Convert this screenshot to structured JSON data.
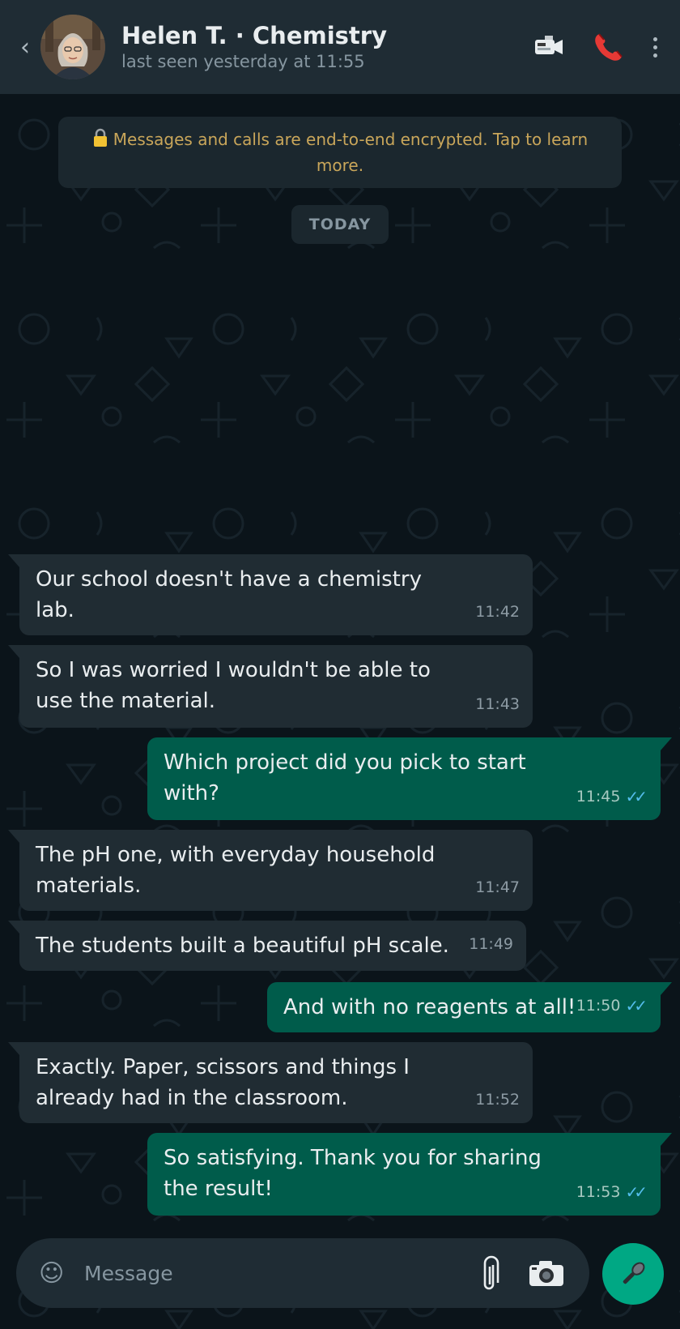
{
  "header": {
    "back_icon": "chevron-left-icon",
    "name": "Helen T. · Chemistry",
    "status": "last seen yesterday at 11:55",
    "icons": [
      "video-call-icon",
      "phone-call-icon",
      "more-vert-icon"
    ]
  },
  "encryption_notice": "Messages and calls are end-to-end encrypted. Tap to learn more.",
  "date_chip": "TODAY",
  "messages": [
    {
      "dir": "in",
      "text": "Our school doesn't have a chemistry lab.",
      "time": "11:42"
    },
    {
      "dir": "in",
      "text": "So I was worried I wouldn't be able to use the material.",
      "time": "11:43"
    },
    {
      "dir": "out",
      "text": "Which project did you pick to start with?",
      "time": "11:45",
      "status": "read"
    },
    {
      "dir": "in",
      "text": "The pH one, with everyday household materials.",
      "time": "11:47"
    },
    {
      "dir": "in",
      "text": "The students built a beautiful pH scale.",
      "time": "11:49"
    },
    {
      "dir": "out",
      "text": "And with no reagents at all!",
      "time": "11:50",
      "status": "read"
    },
    {
      "dir": "in",
      "text": "Exactly. Paper, scissors and things I already had in the classroom.",
      "time": "11:52"
    },
    {
      "dir": "out",
      "text": "So satisfying. Thank you for sharing the result!",
      "time": "11:53",
      "status": "read"
    }
  ],
  "composer": {
    "placeholder": "Message",
    "icons": [
      "emoji-icon",
      "paperclip-icon",
      "camera-icon",
      "microphone-icon"
    ]
  },
  "colors": {
    "background": "#0b141a",
    "header": "#1f2c34",
    "incoming": "#202c33",
    "outgoing": "#005c4b",
    "accent": "#00a884",
    "read_ticks": "#53bdeb",
    "notice_text": "#c9a65a"
  }
}
